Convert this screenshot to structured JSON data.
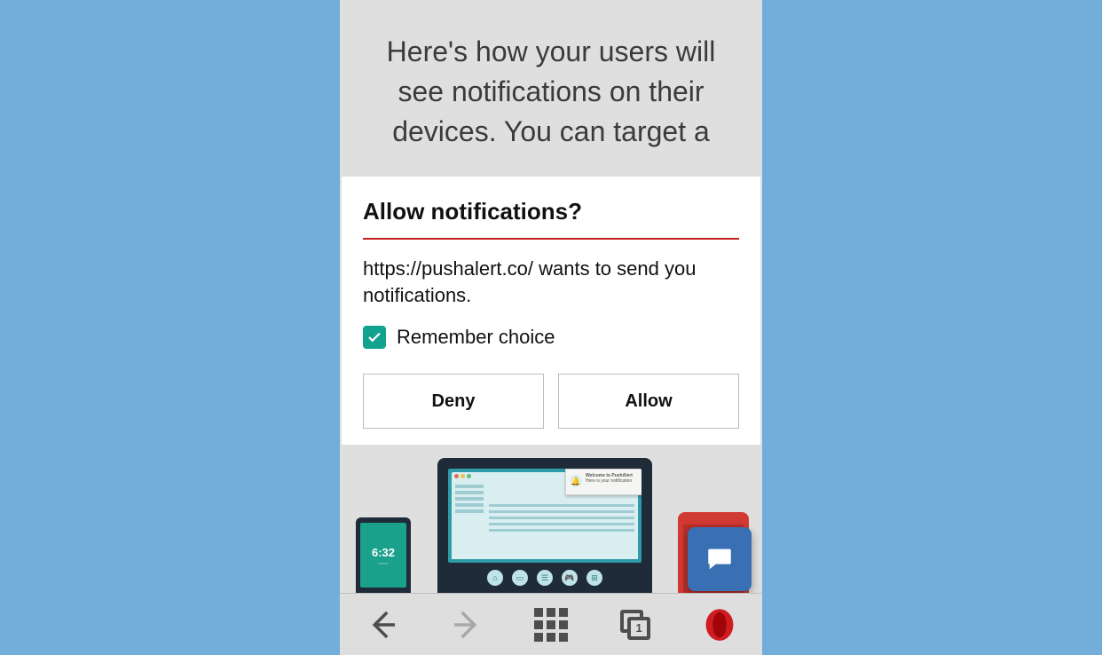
{
  "hero": {
    "text": "Here's how your users will see notifications on their devices. You can target a"
  },
  "dialog": {
    "title": "Allow notifications?",
    "message": "https://pushalert.co/ wants to send you notifications.",
    "remember_label": "Remember choice",
    "deny_label": "Deny",
    "allow_label": "Allow"
  },
  "toolbar": {
    "tab_count": "1"
  },
  "illustration": {
    "phone_time": "6:32",
    "notif_title": "Welcome to PushAlert",
    "notif_body": "Here is your notification"
  }
}
